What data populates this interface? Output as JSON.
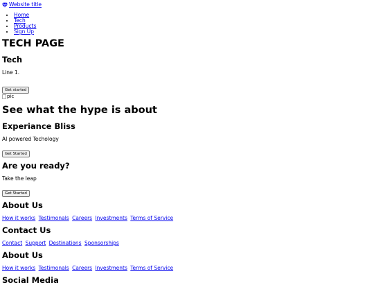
{
  "header": {
    "site_title": "Website title",
    "nav": [
      "Home",
      "Tech",
      "Products",
      "Sign Up"
    ]
  },
  "hero": {
    "page_title": "TECH PAGE",
    "section_heading": "Tech",
    "line": "Line 1.",
    "button": "Get started",
    "image_alt": "pic"
  },
  "hype": {
    "heading": "See what the hype is about"
  },
  "bliss": {
    "heading": "Experiance Bliss",
    "text": "AI powered Techology",
    "button": "Get Started"
  },
  "ready": {
    "heading": "Are you ready?",
    "text": "Take the leap",
    "button": "Get Started"
  },
  "footer": {
    "about1": {
      "heading": "About Us",
      "links": [
        "How it works",
        "Testimonals",
        "Careers",
        "Investments",
        "Terms of Service"
      ]
    },
    "contact": {
      "heading": "Contact Us",
      "links": [
        "Contact",
        "Support",
        "Destinations",
        "Sponsorships"
      ]
    },
    "about2": {
      "heading": "About Us",
      "links": [
        "How it works",
        "Testimonals",
        "Careers",
        "Investments",
        "Terms of Service"
      ]
    },
    "social": {
      "heading": "Social Media"
    }
  },
  "icons": {
    "site_logo": "gem-icon",
    "image": "broken-image-icon"
  }
}
